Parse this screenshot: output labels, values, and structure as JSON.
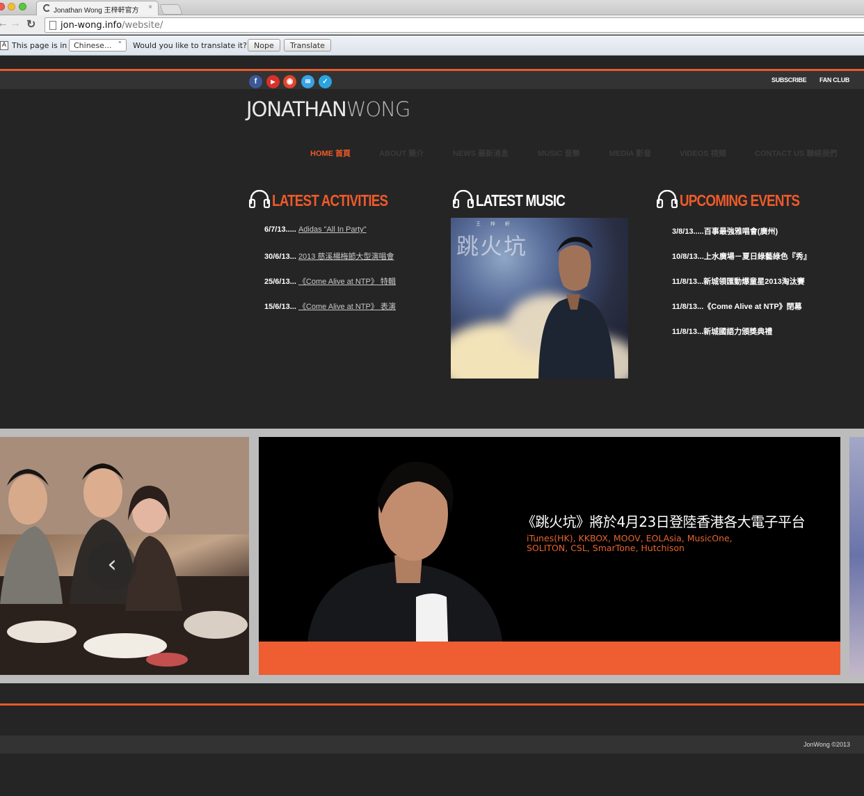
{
  "browser": {
    "tab_title": "Jonathan Wong 王梓軒官方",
    "tab_close": "×",
    "url_host": "jon-wong.info",
    "url_path": "/website/",
    "back_glyph": "←",
    "forward_glyph": "→",
    "reload_glyph": "↻",
    "translate_icon": "A"
  },
  "translate_bar": {
    "this_page_is_in": "This page is in",
    "language": "Chinese...",
    "language_arrow": "⌃",
    "question": "Would you like to translate it?",
    "nope": "Nope",
    "translate": "Translate"
  },
  "social": [
    {
      "name": "facebook",
      "glyph": "f",
      "color": "#3b5998"
    },
    {
      "name": "youtube",
      "glyph": "▶",
      "color": "#d9302a"
    },
    {
      "name": "weibo",
      "glyph": "◉",
      "color": "#e0452b"
    },
    {
      "name": "chat",
      "glyph": "✉",
      "color": "#39a3e6"
    },
    {
      "name": "twitter",
      "glyph": "✓",
      "color": "#2aa3df"
    }
  ],
  "top_links": {
    "subscribe": "SUBSCRIBE",
    "fan_club": "FAN CLUB"
  },
  "logo": {
    "bold": "JONATHAN",
    "thin": "WONG"
  },
  "nav": [
    "HOME 首頁",
    "ABOUT 簡介",
    "NEWS 最新消息",
    "MUSIC 音樂",
    "MEDIA 影音",
    "VIDEOS 視頻",
    "CONTACT US 聯絡我們"
  ],
  "latest_activities": {
    "title": "LATEST ACTIVITIES",
    "items": [
      {
        "date": "6/7/13.....",
        "text": "Adidas \"All In Party\""
      },
      {
        "date": "30/6/13...",
        "text": "2013 慈溪楊梅節大型演唱會"
      },
      {
        "date": "25/6/13...",
        "text": "《Come Alive at NTP》 特輯"
      },
      {
        "date": "15/6/13...",
        "text": "《Come Alive at NTP》 表演"
      }
    ]
  },
  "latest_music": {
    "title": "LATEST MUSIC",
    "album_title": "跳火坑",
    "album_artist": "王梓軒"
  },
  "upcoming_events": {
    "title": "UPCOMING EVENTS",
    "items": [
      "3/8/13.....百事最強雅唱會(廣州)",
      "10/8/13...上水廣場－夏日綠藝綠色『秀』",
      "11/8/13...新城領匯動爆童星2013淘汰賽",
      "11/8/13...《Come Alive at NTP》閉幕",
      "11/8/13...新城國語力頒獎典禮"
    ]
  },
  "slider": {
    "headline": "《跳火坑》將於4月23日登陸香港各大電子平台",
    "subline_1": "iTunes(HK), KKBOX, MOOV, EOLAsia, MusicOne,",
    "subline_2": "SOLITON, CSL, SmarTone, Hutchison",
    "prev_glyph": "‹"
  },
  "footer": {
    "copyright": "JonWong ©2013"
  },
  "colors": {
    "accent": "#ee5a2a",
    "background": "#252525",
    "band": "#333333"
  }
}
